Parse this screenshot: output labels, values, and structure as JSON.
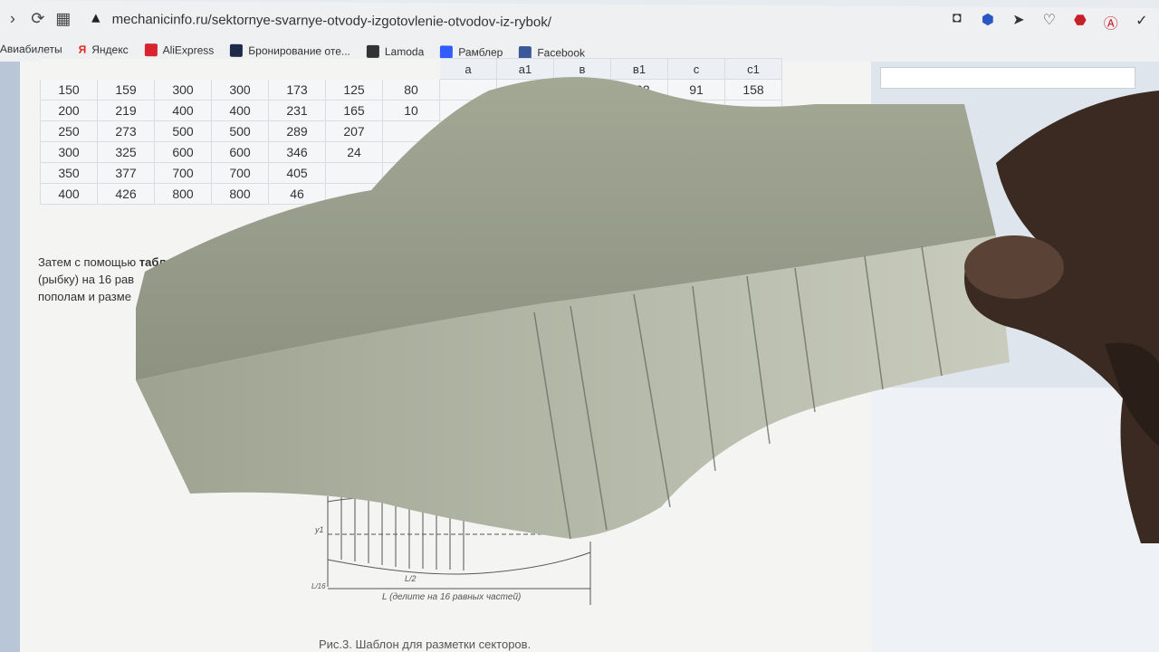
{
  "browser": {
    "url": "mechanicinfo.ru/sektornye-svarnye-otvody-izgotovlenie-otvodov-iz-rybok/",
    "bookmarks": [
      "Авиабилеты",
      "Яндекс",
      "AliExpress",
      "Бронирование оте...",
      "Lamoda",
      "Рамблер",
      "Facebook"
    ]
  },
  "table": {
    "visible_headers": [
      "а",
      "а1",
      "в",
      "в1",
      "с",
      "с1"
    ],
    "rows": [
      [
        "150",
        "159",
        "300",
        "300",
        "173",
        "125",
        "80"
      ],
      [
        "200",
        "219",
        "400",
        "400",
        "231",
        "165",
        "10"
      ],
      [
        "250",
        "273",
        "500",
        "500",
        "289",
        "207",
        ""
      ],
      [
        "300",
        "325",
        "600",
        "600",
        "346",
        "24",
        ""
      ],
      [
        "350",
        "377",
        "700",
        "700",
        "405",
        "",
        ""
      ],
      [
        "400",
        "426",
        "800",
        "800",
        "46",
        "",
        ""
      ]
    ],
    "right_row": [
      "102",
      "91",
      "158"
    ]
  },
  "paragraph": {
    "line1_prefix": "Затем с помощью ",
    "line1_bold": "табл",
    "line2": "(рыбку) на 16 рав",
    "line3": "пополам и разме"
  },
  "drawing": {
    "label_y1": "у1",
    "label_L_over_2": "L/2",
    "label_L_over_16": "L/16",
    "label_L": "L (делите на 16 равных частей)"
  },
  "caption": "Рис.3. Шаблон для разметки секторов.",
  "colors": {
    "paper": "#a9ae9c",
    "paper_dark": "#8f9483",
    "skin": "#3a2a22"
  }
}
